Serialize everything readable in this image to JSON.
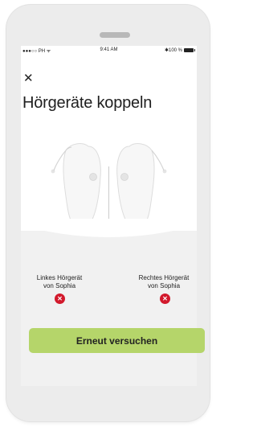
{
  "statusbar": {
    "carrier": "●●●○○ PH ᯤ",
    "time": "9:41 AM",
    "battery": "✱100 %"
  },
  "header": {
    "close_icon": "close-icon",
    "title": "Hörgeräte koppeln"
  },
  "devices": {
    "left": {
      "line1": "Linkes Hörgerät",
      "line2": "von Sophia",
      "status": "error"
    },
    "right": {
      "line1": "Rechtes Hörgerät",
      "line2": "von Sophia",
      "status": "error"
    }
  },
  "actions": {
    "retry_label": "Erneut versuchen"
  },
  "colors": {
    "accent": "#b5d56a",
    "error": "#d2192c",
    "background": "#f1f1f1"
  }
}
